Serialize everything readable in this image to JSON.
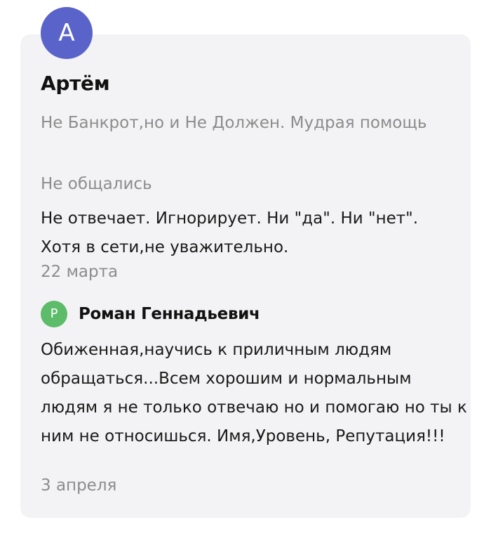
{
  "review": {
    "avatar_letter": "А",
    "author": "Артём",
    "company": "Не Банкрот,но и Не Должен. Мудрая помощь",
    "status": "Не общались",
    "text": "Не отвечает. Игнорирует. Ни \"да\". Ни \"нет\". Хотя в сети,не уважительно.",
    "date": "22 марта"
  },
  "reply": {
    "avatar_letter": "Р",
    "author": "Роман Геннадьевич",
    "text": "Обиженная,научись к приличным людям обращаться...Всем хорошим и нормальным людям я не только отвечаю но и помогаю но ты к ним не относишься.  Имя,Уровень, Репутация!!!",
    "date": "3 апреля"
  },
  "colors": {
    "avatar_primary": "#5a63c9",
    "avatar_reply": "#5cbc6a",
    "card_bg": "#f3f3f5",
    "muted_text": "#8c8c8c"
  }
}
